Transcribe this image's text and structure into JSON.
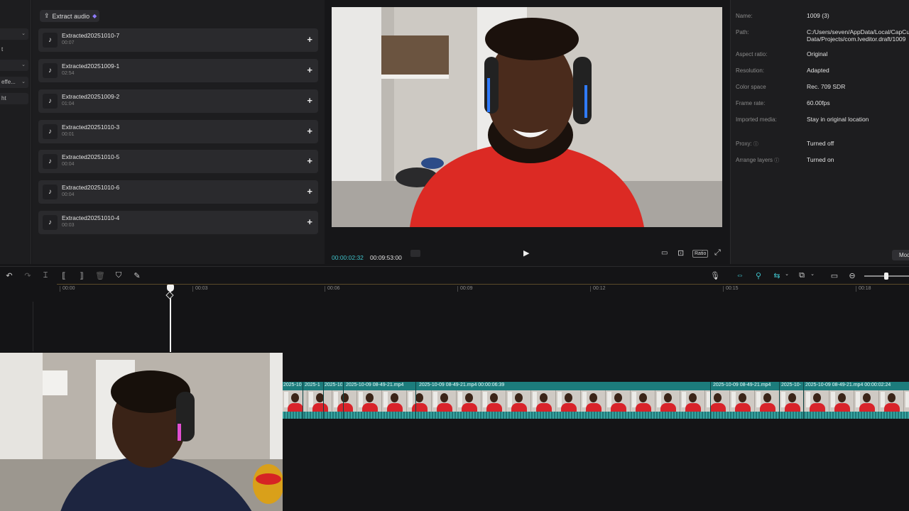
{
  "filters": [
    {
      "label": "",
      "has_chevron": true
    },
    {
      "label": "t",
      "has_chevron": false
    },
    {
      "label": "",
      "has_chevron": true
    },
    {
      "label": "effe...",
      "has_chevron": true
    },
    {
      "label": "ht",
      "has_chevron": false
    }
  ],
  "media": {
    "extract_audio_label": "Extract audio",
    "items": [
      {
        "name": "Extracted20251010-7",
        "duration": "00:07"
      },
      {
        "name": "Extracted20251009-1",
        "duration": "02:54"
      },
      {
        "name": "Extracted20251009-2",
        "duration": "01:04"
      },
      {
        "name": "Extracted20251010-3",
        "duration": "00:01"
      },
      {
        "name": "Extracted20251010-5",
        "duration": "00:04"
      },
      {
        "name": "Extracted20251010-6",
        "duration": "00:04"
      },
      {
        "name": "Extracted20251010-4",
        "duration": "00:03"
      }
    ]
  },
  "player": {
    "current_time": "00:00:02:32",
    "total_time": "00:09:53:00",
    "ratio_label": "Ratio"
  },
  "details": {
    "rows": [
      {
        "label": "Name:",
        "value": "1009 (3)"
      },
      {
        "label": "Path:",
        "value": "C:/Users/seven/AppData/Local/CapCut/User Data/Projects/com.lveditor.draft/1009"
      },
      {
        "label": "Aspect ratio:",
        "value": "Original"
      },
      {
        "label": "Resolution:",
        "value": "Adapted"
      },
      {
        "label": "Color space",
        "value": "Rec. 709 SDR"
      },
      {
        "label": "Frame rate:",
        "value": "60.00fps"
      },
      {
        "label": "Imported media:",
        "value": "Stay in original location"
      },
      {
        "label": "Proxy:",
        "value": "Turned off"
      },
      {
        "label": "Arrange layers",
        "value": "Turned on"
      }
    ],
    "modify_label": "Mod"
  },
  "timeline": {
    "ruler": [
      "00:00",
      "00:03",
      "00:06",
      "00:09",
      "00:12",
      "00:15",
      "00:18"
    ],
    "clips": [
      {
        "label": "2025-10-09 08-49-21.mp4"
      },
      {
        "label": "2025-1"
      },
      {
        "label": "2025-10-09 08-49-21.mp4"
      },
      {
        "label": "2025-10-09 08-49-21.mp4   00:00:06:39"
      },
      {
        "label": "2025-10-09 08-49-21.mp4"
      },
      {
        "label": "2025-10-"
      },
      {
        "label": "2025-10-09 08-49-21.mp4   00:00:02:24"
      }
    ]
  },
  "colors": {
    "accent": "#1c7c7c",
    "timecode": "#3fc1c9",
    "shirt": "#d8232a"
  }
}
